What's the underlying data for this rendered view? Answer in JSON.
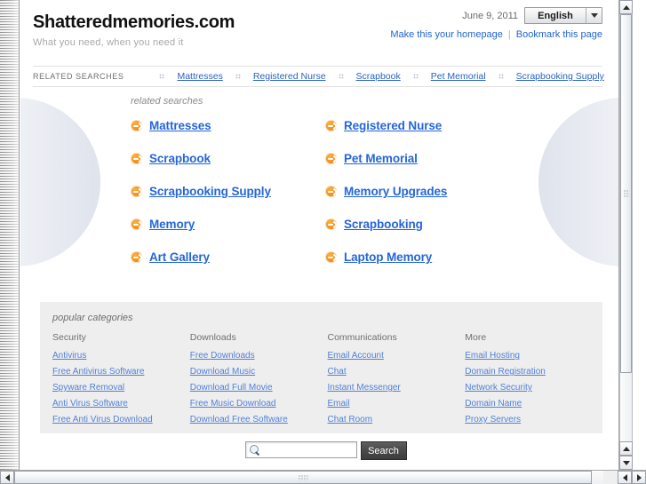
{
  "header": {
    "site_title": "Shatteredmemories.com",
    "tagline": "What you need, when you need it",
    "date": "June 9, 2011",
    "language": "English",
    "homepage_link": "Make this your homepage",
    "separator": "|",
    "bookmark_link": "Bookmark this page"
  },
  "related_bar": {
    "label": "RELATED SEARCHES",
    "links": [
      "Mattresses",
      "Registered Nurse",
      "Scrapbook",
      "Pet Memorial",
      "Scrapbooking Supply"
    ]
  },
  "hero": {
    "title": "related searches",
    "links": [
      "Mattresses",
      "Registered Nurse",
      "Scrapbook",
      "Pet Memorial",
      "Scrapbooking Supply",
      "Memory Upgrades",
      "Memory",
      "Scrapbooking",
      "Art Gallery",
      "Laptop Memory"
    ]
  },
  "categories": {
    "title": "popular categories",
    "columns": [
      {
        "heading": "Security",
        "links": [
          "Antivirus",
          "Free Antivirus Software",
          "Spyware Removal",
          "Anti Virus Software",
          "Free Anti Virus Download"
        ]
      },
      {
        "heading": "Downloads",
        "links": [
          "Free Downloads",
          "Download Music",
          "Download Full Movie",
          "Free Music Download",
          "Download Free Software"
        ]
      },
      {
        "heading": "Communications",
        "links": [
          "Email Account",
          "Chat",
          "Instant Messenger",
          "Email",
          "Chat Room"
        ]
      },
      {
        "heading": "More",
        "links": [
          "Email Hosting",
          "Domain Registration",
          "Network Security",
          "Domain Name",
          "Proxy Servers"
        ]
      }
    ]
  },
  "search": {
    "value": "",
    "placeholder": "",
    "button_label": "Search"
  },
  "colors": {
    "link_blue": "#2566d8",
    "bar_link_blue": "#2b62c6",
    "category_link_blue": "#5181d6",
    "arrow_orange": "#f08a12",
    "category_bg": "#eeeeee",
    "search_button_bg": "#4a4a4a"
  }
}
